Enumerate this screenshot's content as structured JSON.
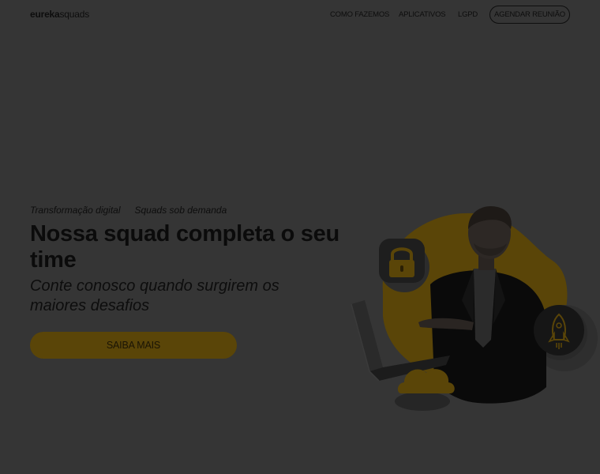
{
  "header": {
    "brand_bold": "eureka",
    "brand_light": "squads",
    "nav": [
      "COMO FAZEMOS",
      "APLICATIVOS",
      "LGPD"
    ],
    "cta": "AGENDAR REUNIÃO"
  },
  "hero": {
    "tags": [
      "Transformação digital",
      "Squads sob demanda"
    ],
    "title": "Nossa squad completa o seu time",
    "subtitle": "Conte conosco quando surgirem os maiores desafios",
    "button": "SAIBA MAIS"
  },
  "illustration": {
    "icons": [
      "lock-icon",
      "rocket-icon",
      "cloud-icon",
      "laptop-icon"
    ],
    "accent_color": "#5a4508",
    "overlay_color": "#353535"
  }
}
